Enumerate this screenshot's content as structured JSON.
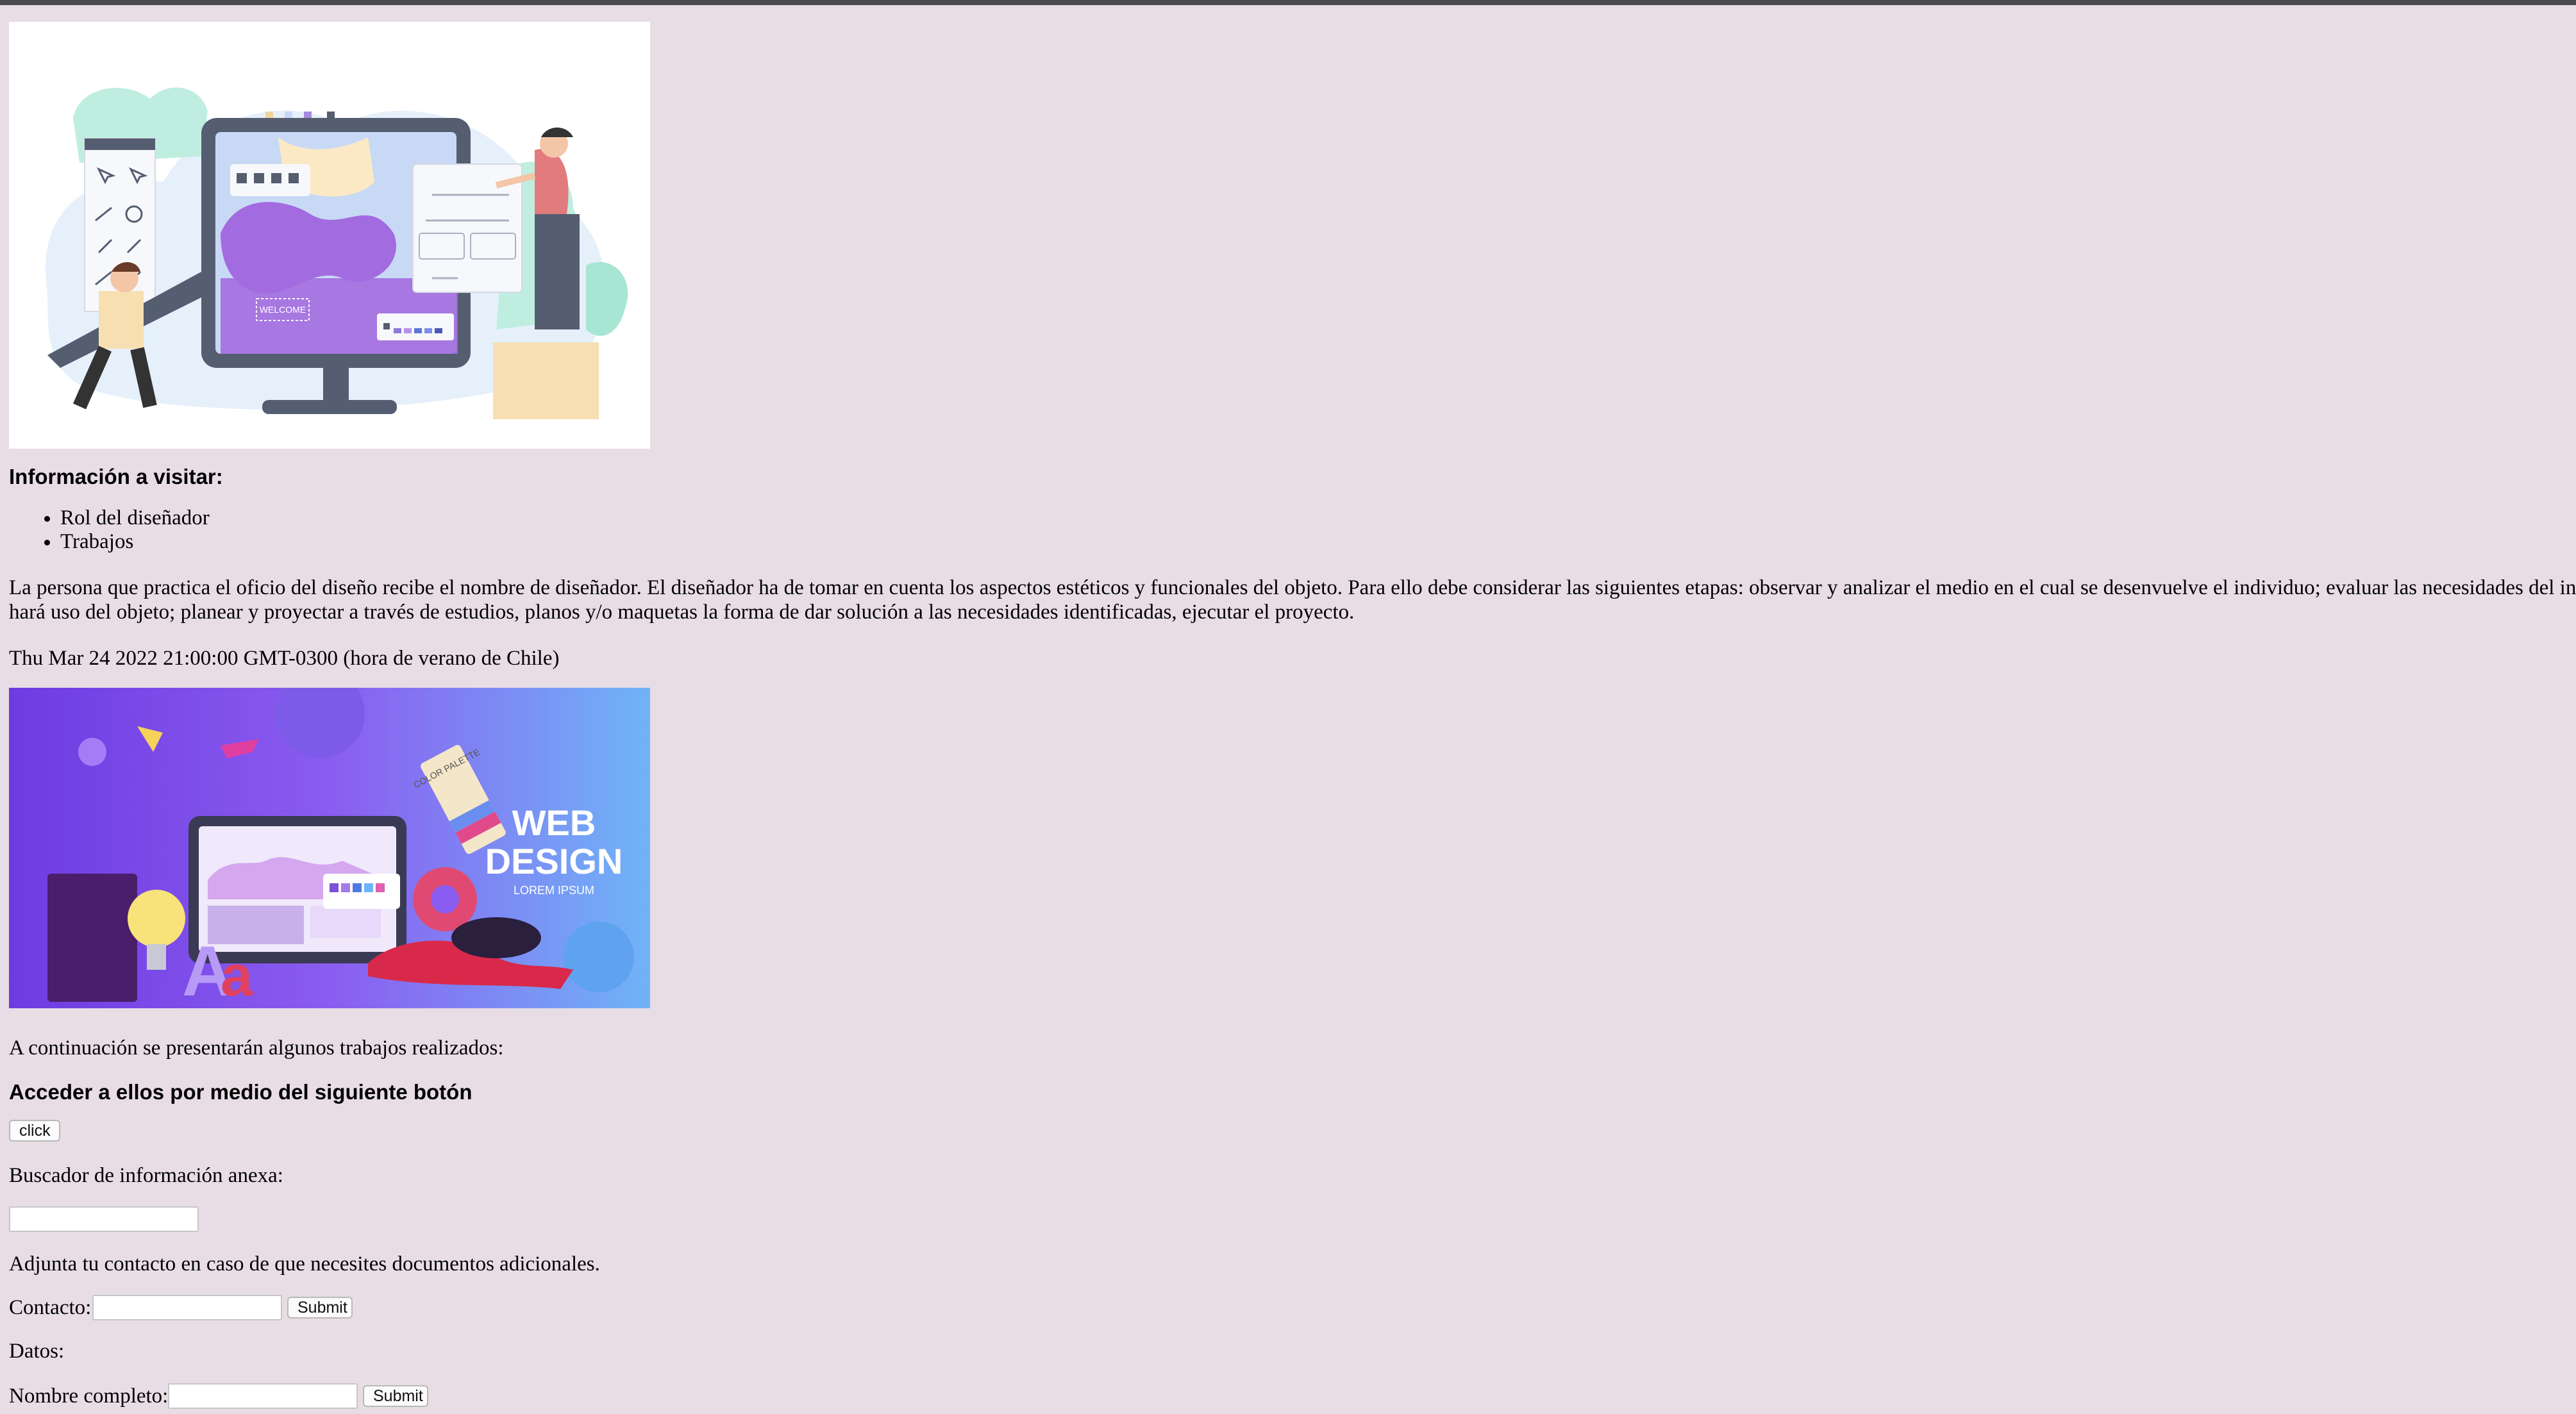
{
  "section_title": "Información a visitar:",
  "list_items": [
    "Rol del diseñador",
    "Trabajos"
  ],
  "paragraph": {
    "line1": "La persona que practica el oficio del diseño recibe el nombre de diseñador. El diseñador ha de tomar en cuenta los aspectos estéticos y funcionales del objeto. Para ello debe considerar las siguientes etapas: observar y analizar el medio en el cual se desenvuelve el individuo; evaluar las necesidades del individuo q",
    "line2": "hará uso del objeto; planear y proyectar a través de estudios, planos y/o maquetas la forma de dar solución a las necesidades identificadas, ejecutar el proyecto."
  },
  "date_text": "Thu Mar 24 2022 21:00:00 GMT-0300 (hora de verano de Chile)",
  "hero2": {
    "title_line1": "WEB",
    "title_line2": "DESIGN",
    "subtitle": "LOREM IPSUM",
    "palette_label": "COLOR PALETTE"
  },
  "hero1": {
    "welcome_label": "WELCOME"
  },
  "works_intro": "A continuación se presentarán algunos trabajos realizados:",
  "access_heading": "Acceder a ellos por medio del siguiente botón",
  "click_button": "click",
  "search_label": "Buscador de información anexa:",
  "search_value": "",
  "attach_text": "Adjunta tu contacto en caso de que necesites documentos adicionales.",
  "contact_label": "Contacto:",
  "contact_value": "",
  "submit_label": "Submit",
  "datos_label": "Datos:",
  "name_label": "Nombre completo:",
  "name_value": "",
  "colors": {
    "background": "#e8dde5",
    "topbar": "#4a4a4e",
    "purple_accent": "#9b6bdc"
  }
}
